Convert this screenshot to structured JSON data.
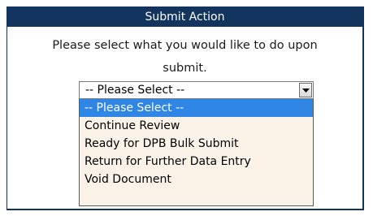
{
  "dialog": {
    "title": "Submit Action",
    "prompt_line1": "Please select what you would like to do upon",
    "prompt_line2": "submit."
  },
  "select": {
    "current_value": "-- Please Select --",
    "options": [
      "-- Please Select --",
      "Continue Review",
      "Ready for DPB Bulk Submit",
      "Return for Further Data Entry",
      "Void Document"
    ],
    "highlighted_index": 0,
    "highlight_color": "#2f86e5",
    "list_background": "#fbf3e7"
  },
  "colors": {
    "titlebar": "#12345f"
  }
}
